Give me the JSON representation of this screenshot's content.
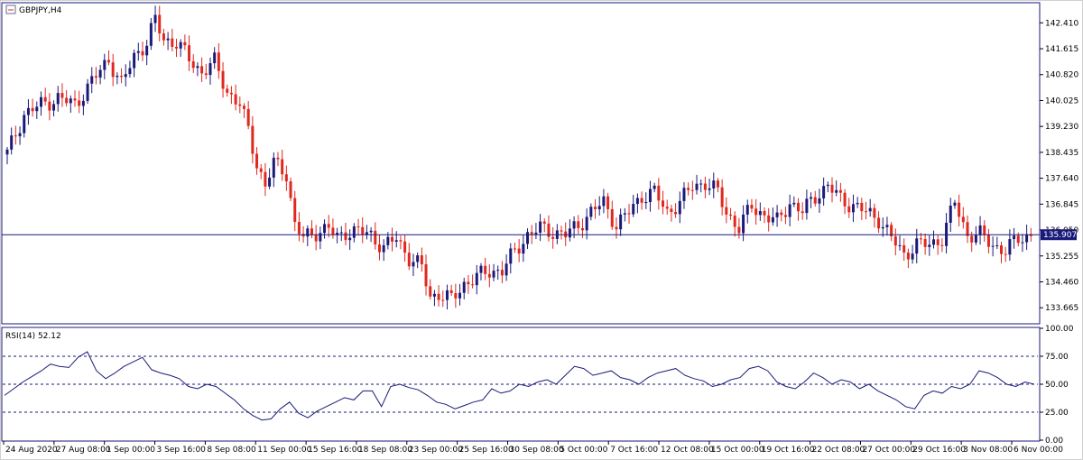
{
  "window": {
    "symbol_title": "GBPJPY,H4",
    "icon": "chart-window-icon",
    "current_price": "135.907"
  },
  "colors": {
    "bull": "#1a1a7a",
    "bear": "#e0281e",
    "line": "#1a1a7a",
    "frame": "#1a1a7a",
    "price_box_bg": "#1a1a7a",
    "price_box_fg": "#ffffff"
  },
  "rsi_label": "RSI(14) 52.12",
  "chart_data": [
    {
      "type": "candlestick",
      "title": "GBPJPY,H4",
      "ylim": [
        133.2,
        143.0
      ],
      "y_ticks": [
        "142.410",
        "141.615",
        "140.820",
        "140.025",
        "139.230",
        "138.435",
        "137.640",
        "136.845",
        "136.050",
        "135.255",
        "134.460",
        "133.665"
      ],
      "y_tick_values": [
        142.41,
        141.615,
        140.82,
        140.025,
        139.23,
        138.435,
        137.64,
        136.845,
        136.05,
        135.255,
        134.46,
        133.665
      ],
      "x_ticks": [
        "24 Aug 2020",
        "27 Aug 08:00",
        "1 Sep 00:00",
        "3 Sep 16:00",
        "8 Sep 08:00",
        "11 Sep 00:00",
        "15 Sep 16:00",
        "18 Sep 08:00",
        "23 Sep 00:00",
        "25 Sep 16:00",
        "30 Sep 08:00",
        "5 Oct 00:00",
        "7 Oct 16:00",
        "12 Oct 08:00",
        "15 Oct 00:00",
        "19 Oct 16:00",
        "22 Oct 08:00",
        "27 Oct 00:00",
        "29 Oct 16:00",
        "3 Nov 08:00",
        "6 Nov 00:00"
      ],
      "horizontal_line": 135.907,
      "series": [
        {
          "kind": "close-path",
          "points": [
            [
              0,
              138.4
            ],
            [
              4,
              139.6
            ],
            [
              8,
              139.9
            ],
            [
              12,
              140.1
            ],
            [
              16,
              139.9
            ],
            [
              20,
              140.6
            ],
            [
              24,
              141.3
            ],
            [
              27,
              140.5
            ],
            [
              30,
              141.4
            ],
            [
              33,
              141.8
            ],
            [
              35,
              142.5
            ],
            [
              37,
              141.9
            ],
            [
              40,
              141.8
            ],
            [
              43,
              141.3
            ],
            [
              46,
              140.9
            ],
            [
              49,
              141.2
            ],
            [
              52,
              140.3
            ],
            [
              55,
              139.9
            ],
            [
              57,
              139.1
            ],
            [
              59,
              138.1
            ],
            [
              61,
              137.4
            ],
            [
              63,
              138.1
            ],
            [
              66,
              137.8
            ],
            [
              68,
              136.2
            ],
            [
              70,
              135.8
            ],
            [
              73,
              136.0
            ],
            [
              76,
              136.1
            ],
            [
              78,
              135.8
            ],
            [
              80,
              136.0
            ],
            [
              83,
              136.0
            ],
            [
              86,
              135.9
            ],
            [
              89,
              135.5
            ],
            [
              92,
              135.8
            ],
            [
              95,
              135.2
            ],
            [
              98,
              134.9
            ],
            [
              100,
              134.0
            ],
            [
              102,
              134.1
            ],
            [
              105,
              133.9
            ],
            [
              108,
              134.4
            ],
            [
              111,
              134.6
            ],
            [
              114,
              134.8
            ],
            [
              117,
              134.8
            ],
            [
              120,
              135.4
            ],
            [
              123,
              135.9
            ],
            [
              126,
              136.1
            ],
            [
              129,
              136.0
            ],
            [
              132,
              135.9
            ],
            [
              135,
              136.2
            ],
            [
              138,
              136.6
            ],
            [
              141,
              136.9
            ],
            [
              144,
              136.2
            ],
            [
              147,
              136.6
            ],
            [
              150,
              137.1
            ],
            [
              153,
              137.2
            ],
            [
              156,
              136.6
            ],
            [
              159,
              136.9
            ],
            [
              162,
              137.4
            ],
            [
              165,
              137.5
            ],
            [
              168,
              137.2
            ],
            [
              170,
              136.6
            ],
            [
              173,
              136.1
            ],
            [
              176,
              136.8
            ],
            [
              179,
              136.5
            ],
            [
              182,
              136.3
            ],
            [
              185,
              136.9
            ],
            [
              188,
              136.6
            ],
            [
              191,
              137.1
            ],
            [
              194,
              137.4
            ],
            [
              197,
              137.0
            ],
            [
              200,
              136.8
            ],
            [
              203,
              136.6
            ],
            [
              206,
              136.4
            ],
            [
              209,
              135.8
            ],
            [
              212,
              135.3
            ],
            [
              215,
              135.6
            ],
            [
              218,
              135.6
            ],
            [
              221,
              135.8
            ],
            [
              224,
              136.9
            ],
            [
              227,
              135.9
            ],
            [
              230,
              135.9
            ],
            [
              233,
              135.6
            ],
            [
              236,
              135.4
            ],
            [
              239,
              135.8
            ],
            [
              242,
              135.9
            ]
          ]
        }
      ]
    },
    {
      "type": "line",
      "title": "RSI(14) 52.12",
      "ylim": [
        0,
        100
      ],
      "y_ticks": [
        "100.00",
        "75.00",
        "50.00",
        "25.00",
        "0.00"
      ],
      "y_tick_values": [
        100,
        75,
        50,
        25,
        0
      ],
      "levels": [
        75,
        50,
        25
      ],
      "series": [
        {
          "name": "RSI(14)",
          "values": [
            40,
            46,
            52,
            57,
            62,
            68,
            66,
            65,
            74,
            79,
            62,
            55,
            60,
            66,
            70,
            74,
            63,
            60,
            58,
            55,
            48,
            46,
            50,
            48,
            42,
            36,
            28,
            22,
            18,
            19,
            28,
            34,
            24,
            20,
            26,
            30,
            34,
            38,
            36,
            44,
            44,
            30,
            48,
            50,
            47,
            45,
            40,
            34,
            32,
            28,
            31,
            34,
            36,
            46,
            42,
            44,
            50,
            48,
            52,
            54,
            50,
            58,
            66,
            64,
            58,
            60,
            62,
            56,
            54,
            50,
            56,
            60,
            62,
            64,
            58,
            55,
            53,
            48,
            50,
            54,
            56,
            64,
            66,
            62,
            52,
            48,
            46,
            52,
            60,
            56,
            50,
            54,
            52,
            46,
            50,
            44,
            40,
            36,
            30,
            28,
            40,
            44,
            42,
            48,
            46,
            50,
            62,
            60,
            56,
            50,
            48,
            52,
            50
          ]
        }
      ]
    }
  ]
}
